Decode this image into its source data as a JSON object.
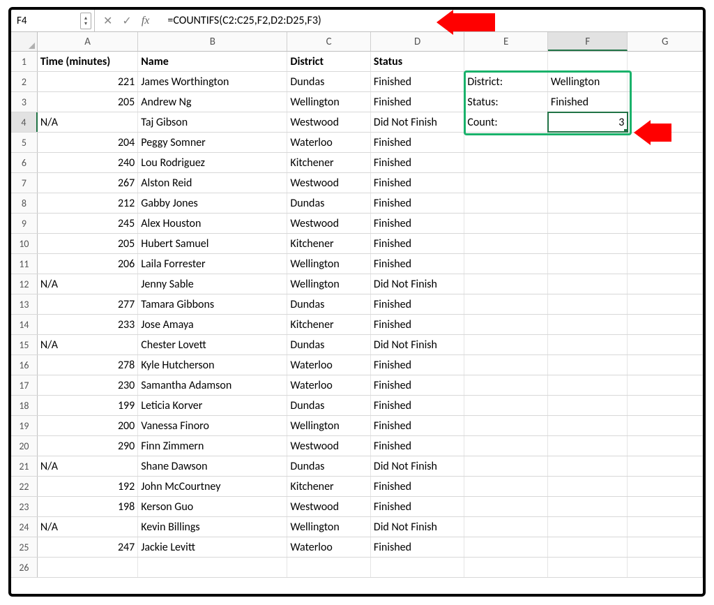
{
  "namebox": "F4",
  "formula": "=COUNTIFS(C2:C25,F2,D2:D25,F3)",
  "columns": [
    "A",
    "B",
    "C",
    "D",
    "E",
    "F",
    "G"
  ],
  "headers": {
    "A": "Time (minutes)",
    "B": "Name",
    "C": "District",
    "D": "Status"
  },
  "criteria": {
    "district_label": "District:",
    "district_value": "Wellington",
    "status_label": "Status:",
    "status_value": "Finished",
    "count_label": "Count:",
    "count_value": "3"
  },
  "rows": [
    {
      "time": "221",
      "name": "James Worthington",
      "district": "Dundas",
      "status": "Finished"
    },
    {
      "time": "205",
      "name": "Andrew Ng",
      "district": "Wellington",
      "status": "Finished"
    },
    {
      "time": "N/A",
      "name": "Taj Gibson",
      "district": "Westwood",
      "status": "Did Not Finish"
    },
    {
      "time": "204",
      "name": "Peggy Somner",
      "district": "Waterloo",
      "status": "Finished"
    },
    {
      "time": "240",
      "name": "Lou Rodriguez",
      "district": "Kitchener",
      "status": "Finished"
    },
    {
      "time": "267",
      "name": "Alston Reid",
      "district": "Westwood",
      "status": "Finished"
    },
    {
      "time": "212",
      "name": "Gabby Jones",
      "district": "Dundas",
      "status": "Finished"
    },
    {
      "time": "245",
      "name": "Alex Houston",
      "district": "Westwood",
      "status": "Finished"
    },
    {
      "time": "205",
      "name": "Hubert Samuel",
      "district": "Kitchener",
      "status": "Finished"
    },
    {
      "time": "206",
      "name": "Laila Forrester",
      "district": "Wellington",
      "status": "Finished"
    },
    {
      "time": "N/A",
      "name": "Jenny Sable",
      "district": "Wellington",
      "status": "Did Not Finish"
    },
    {
      "time": "277",
      "name": "Tamara Gibbons",
      "district": "Dundas",
      "status": "Finished"
    },
    {
      "time": "233",
      "name": "Jose Amaya",
      "district": "Kitchener",
      "status": "Finished"
    },
    {
      "time": "N/A",
      "name": "Chester Lovett",
      "district": "Dundas",
      "status": "Did Not Finish"
    },
    {
      "time": "278",
      "name": "Kyle Hutcherson",
      "district": "Waterloo",
      "status": "Finished"
    },
    {
      "time": "230",
      "name": "Samantha Adamson",
      "district": "Waterloo",
      "status": "Finished"
    },
    {
      "time": "199",
      "name": "Leticia Korver",
      "district": "Dundas",
      "status": "Finished"
    },
    {
      "time": "200",
      "name": "Vanessa Finoro",
      "district": "Wellington",
      "status": "Finished"
    },
    {
      "time": "290",
      "name": "Finn Zimmern",
      "district": "Westwood",
      "status": "Finished"
    },
    {
      "time": "N/A",
      "name": "Shane Dawson",
      "district": "Dundas",
      "status": "Did Not Finish"
    },
    {
      "time": "192",
      "name": "John McCourtney",
      "district": "Kitchener",
      "status": "Finished"
    },
    {
      "time": "198",
      "name": "Kerson Guo",
      "district": "Westwood",
      "status": "Finished"
    },
    {
      "time": "N/A",
      "name": "Kevin Billings",
      "district": "Wellington",
      "status": "Did Not Finish"
    },
    {
      "time": "247",
      "name": "Jackie Levitt",
      "district": "Waterloo",
      "status": "Finished"
    }
  ]
}
